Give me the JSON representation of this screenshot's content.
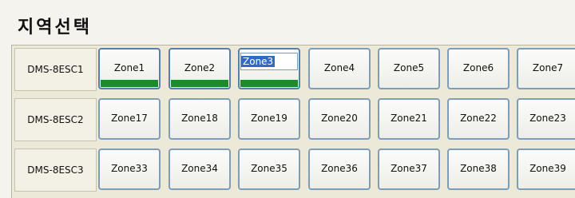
{
  "title": "지역선택",
  "rows": [
    {
      "label": "DMS-8ESC1",
      "zones": [
        {
          "name": "Zone1",
          "active": true
        },
        {
          "name": "Zone2",
          "active": true
        },
        {
          "name": "Zone3",
          "active": true,
          "editing": true
        },
        {
          "name": "Zone4",
          "active": false
        },
        {
          "name": "Zone5",
          "active": false
        },
        {
          "name": "Zone6",
          "active": false
        },
        {
          "name": "Zone7",
          "active": false
        }
      ]
    },
    {
      "label": "DMS-8ESC2",
      "zones": [
        {
          "name": "Zone17",
          "active": false
        },
        {
          "name": "Zone18",
          "active": false
        },
        {
          "name": "Zone19",
          "active": false
        },
        {
          "name": "Zone20",
          "active": false
        },
        {
          "name": "Zone21",
          "active": false
        },
        {
          "name": "Zone22",
          "active": false
        },
        {
          "name": "Zone23",
          "active": false
        }
      ]
    },
    {
      "label": "DMS-8ESC3",
      "zones": [
        {
          "name": "Zone33",
          "active": false
        },
        {
          "name": "Zone34",
          "active": false
        },
        {
          "name": "Zone35",
          "active": false
        },
        {
          "name": "Zone36",
          "active": false
        },
        {
          "name": "Zone37",
          "active": false
        },
        {
          "name": "Zone38",
          "active": false
        },
        {
          "name": "Zone39",
          "active": false
        }
      ]
    }
  ],
  "colors": {
    "active_bar": "#1e8a2b",
    "selection": "#316ac5",
    "button_border": "#7f9db9"
  }
}
